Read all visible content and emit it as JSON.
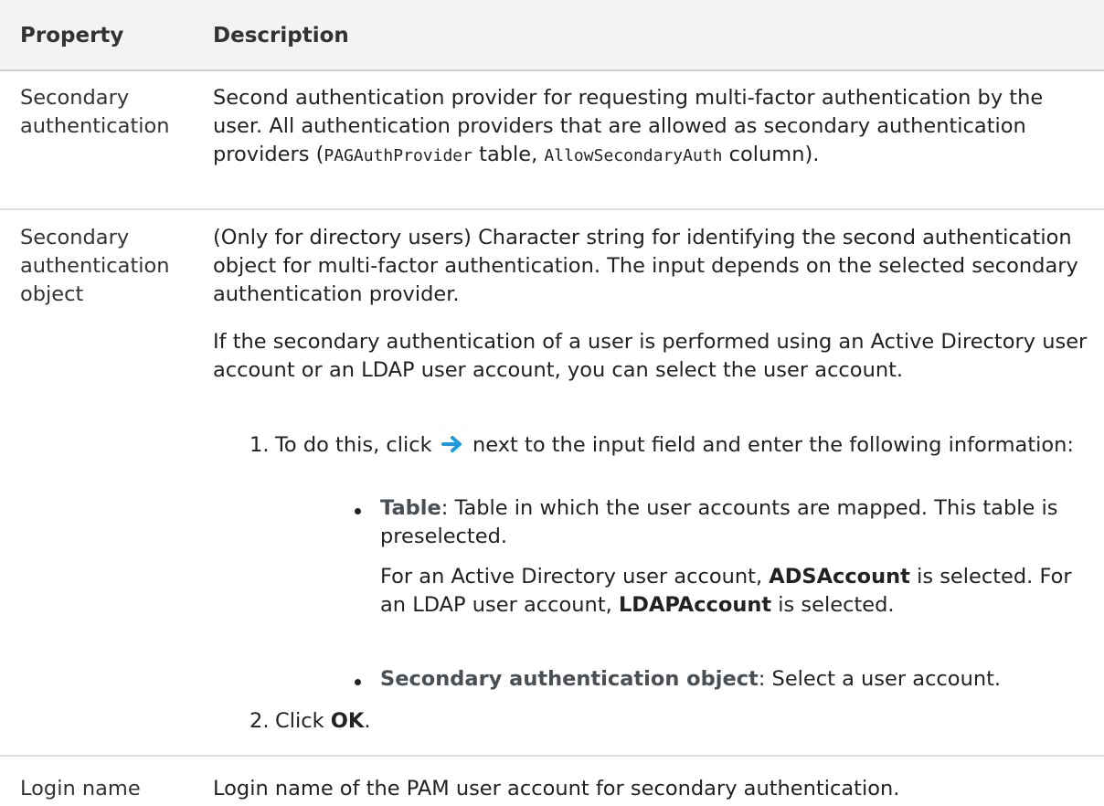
{
  "header": {
    "col1": "Property",
    "col2": "Description"
  },
  "rows": [
    {
      "property": [
        "Secondary",
        "authentication"
      ],
      "description": {
        "text1": "Second authentication provider for requesting multi-factor authentication by the user. All authentication providers that are allowed as secondary authentication providers (",
        "code1": "PAGAuthProvider",
        "text2": " table, ",
        "code2": "AllowSecondaryAuth",
        "text3": " column)."
      }
    },
    {
      "property": [
        "Secondary",
        "authentication",
        "object"
      ],
      "description": {
        "para1": "(Only for directory users) Character string for identifying the second authentication object for multi-factor authentication. The input depends on the selected secondary authentication provider.",
        "para2": "If the secondary authentication of a user is performed using an Active Directory user account or an LDAP user account, you can select the user account.",
        "step1_num": "1.",
        "step1_before_icon": "To do this, click",
        "step1_icon": "arrow-right-icon",
        "step1_after_icon": "next to the input field and enter the following information:",
        "bullet1_label": "Table",
        "bullet1_text": ": Table in which the user accounts are mapped. This table is preselected.",
        "bullet1_sub_a": "For an Active Directory user account, ",
        "bullet1_sub_b": "ADSAccount",
        "bullet1_sub_c": " is selected. For an LDAP user account, ",
        "bullet1_sub_d": "LDAPAccount",
        "bullet1_sub_e": " is selected.",
        "bullet2_label": "Secondary authentication object",
        "bullet2_text": ": Select a user account.",
        "step2_num": "2.",
        "step2_before": "Click ",
        "step2_bold": "OK",
        "step2_after": "."
      }
    },
    {
      "property": [
        "Login name"
      ],
      "description": {
        "text": "Login name of the PAM user account for secondary authentication."
      }
    }
  ],
  "colors": {
    "arrow": "#1e9be0",
    "header_bg": "#f3f3f3",
    "divider": "#dddddd"
  }
}
